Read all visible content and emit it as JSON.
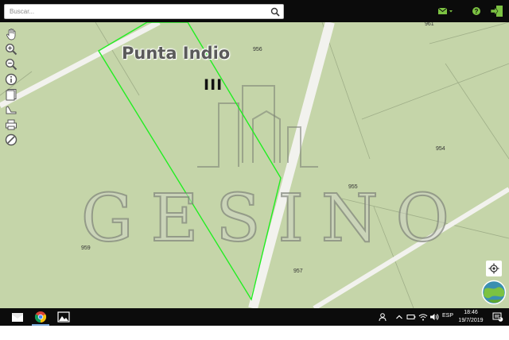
{
  "search": {
    "placeholder": "Buscar..."
  },
  "icons": {
    "search": "search-icon",
    "mail": "mail-icon",
    "help": "help-icon",
    "logout": "logout-icon",
    "pan": "hand-pan-icon",
    "zoom_in": "zoom-in-icon",
    "zoom_out": "zoom-out-icon",
    "info": "info-icon",
    "layers": "layers-icon",
    "measure": "measure-icon",
    "print": "print-icon",
    "street": "street-icon",
    "locate": "locate-icon",
    "globe": "globe-logo-icon"
  },
  "map": {
    "town_label": "Punta Indio",
    "zone_label": "III",
    "parcels": [
      "956",
      "961",
      "954",
      "955",
      "959",
      "957"
    ],
    "watermark": "GESINO",
    "colors": {
      "background": "#c5d5a9",
      "parcel_outline": "#22ee22",
      "road": "#f2f2ee"
    }
  },
  "taskbar": {
    "apps": [
      "file-explorer-icon",
      "chrome-icon",
      "photos-icon"
    ],
    "language": "ESP",
    "time": "18:46",
    "date": "19/7/2019",
    "notification_count": "1"
  },
  "colors": {
    "accent_green": "#7cc242",
    "topbar": "#0b0b0b"
  }
}
